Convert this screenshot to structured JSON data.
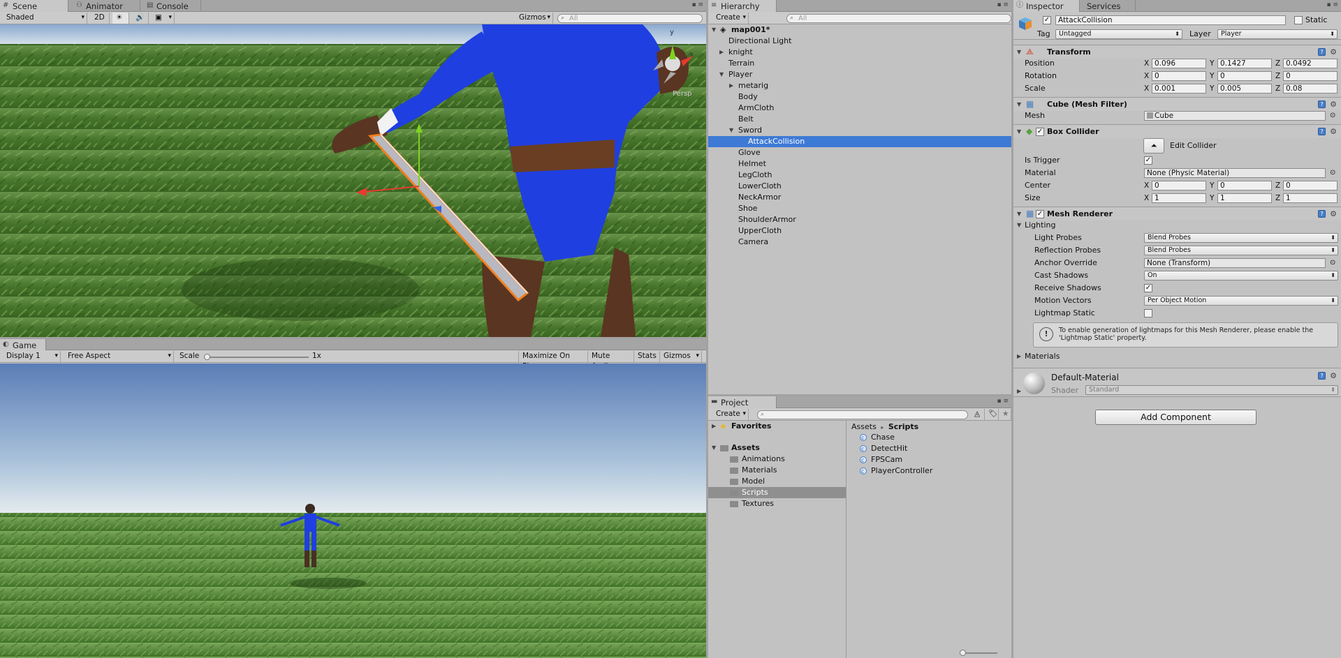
{
  "scene": {
    "tabs": [
      "Scene",
      "Animator",
      "Console"
    ],
    "shading": "Shaded",
    "mode_2d": "2D",
    "gizmos": "Gizmos",
    "search_placeholder": "All",
    "persp": "Persp",
    "axis_y": "y",
    "axis_x": "x"
  },
  "game": {
    "tab": "Game",
    "display": "Display 1",
    "aspect": "Free Aspect",
    "scale_label": "Scale",
    "scale_value": "1x",
    "maximize": "Maximize On Play",
    "mute": "Mute Audio",
    "stats": "Stats",
    "gizmos": "Gizmos"
  },
  "hierarchy": {
    "tab": "Hierarchy",
    "create": "Create",
    "search_placeholder": "All",
    "scene_name": "map001*",
    "items": [
      {
        "label": "Directional Light",
        "indent": 0,
        "arrow": ""
      },
      {
        "label": "knight",
        "indent": 0,
        "arrow": "right"
      },
      {
        "label": "Terrain",
        "indent": 0,
        "arrow": ""
      },
      {
        "label": "Player",
        "indent": 0,
        "arrow": "down"
      },
      {
        "label": "metarig",
        "indent": 1,
        "arrow": "right"
      },
      {
        "label": "Body",
        "indent": 1,
        "arrow": ""
      },
      {
        "label": "ArmCloth",
        "indent": 1,
        "arrow": ""
      },
      {
        "label": "Belt",
        "indent": 1,
        "arrow": ""
      },
      {
        "label": "Sword",
        "indent": 1,
        "arrow": "down"
      },
      {
        "label": "AttackCollision",
        "indent": 2,
        "arrow": "",
        "selected": true
      },
      {
        "label": "Glove",
        "indent": 1,
        "arrow": ""
      },
      {
        "label": "Helmet",
        "indent": 1,
        "arrow": ""
      },
      {
        "label": "LegCloth",
        "indent": 1,
        "arrow": ""
      },
      {
        "label": "LowerCloth",
        "indent": 1,
        "arrow": ""
      },
      {
        "label": "NeckArmor",
        "indent": 1,
        "arrow": ""
      },
      {
        "label": "Shoe",
        "indent": 1,
        "arrow": ""
      },
      {
        "label": "ShoulderArmor",
        "indent": 1,
        "arrow": ""
      },
      {
        "label": "UpperCloth",
        "indent": 1,
        "arrow": ""
      },
      {
        "label": "Camera",
        "indent": 1,
        "arrow": ""
      }
    ]
  },
  "project": {
    "tab": "Project",
    "create": "Create",
    "favorites": "Favorites",
    "assets": "Assets",
    "folders": [
      "Animations",
      "Materials",
      "Model",
      "Scripts",
      "Textures"
    ],
    "selected_folder": "Scripts",
    "breadcrumb_root": "Assets",
    "breadcrumb_sep": "▸",
    "breadcrumb_current": "Scripts",
    "files": [
      "Chase",
      "DetectHit",
      "FPSCam",
      "PlayerController"
    ]
  },
  "inspector": {
    "tabs": [
      "Inspector",
      "Services"
    ],
    "object_name": "AttackCollision",
    "static_label": "Static",
    "tag_label": "Tag",
    "tag_value": "Untagged",
    "layer_label": "Layer",
    "layer_value": "Player",
    "transform": {
      "title": "Transform",
      "position_label": "Position",
      "rotation_label": "Rotation",
      "scale_label": "Scale",
      "position": [
        "0.096",
        "0.1427",
        "0.0492"
      ],
      "rotation": [
        "0",
        "0",
        "0"
      ],
      "scale": [
        "0.001",
        "0.005",
        "0.08"
      ]
    },
    "mesh_filter": {
      "title": "Cube (Mesh Filter)",
      "mesh_label": "Mesh",
      "mesh_value": "Cube"
    },
    "box_collider": {
      "title": "Box Collider",
      "edit_collider": "Edit Collider",
      "is_trigger_label": "Is Trigger",
      "material_label": "Material",
      "material_value": "None (Physic Material)",
      "center_label": "Center",
      "center": [
        "0",
        "0",
        "0"
      ],
      "size_label": "Size",
      "size": [
        "1",
        "1",
        "1"
      ]
    },
    "mesh_renderer": {
      "title": "Mesh Renderer",
      "lighting_label": "Lighting",
      "light_probes_label": "Light Probes",
      "light_probes_value": "Blend Probes",
      "reflection_probes_label": "Reflection Probes",
      "reflection_probes_value": "Blend Probes",
      "anchor_override_label": "Anchor Override",
      "anchor_override_value": "None (Transform)",
      "cast_shadows_label": "Cast Shadows",
      "cast_shadows_value": "On",
      "receive_shadows_label": "Receive Shadows",
      "motion_vectors_label": "Motion Vectors",
      "motion_vectors_value": "Per Object Motion",
      "lightmap_static_label": "Lightmap Static",
      "info_text": "To enable generation of lightmaps for this Mesh Renderer, please enable the 'Lightmap Static' property.",
      "materials_label": "Materials"
    },
    "material": {
      "name": "Default-Material",
      "shader_label": "Shader",
      "shader_value": "Standard"
    },
    "add_component": "Add Component",
    "axis_x": "X",
    "axis_y": "Y",
    "axis_z": "Z",
    "check": "✓"
  },
  "colors": {
    "selection": "#3d7ad6",
    "selection_outline": "#f08020",
    "player_blue": "#1f3fe0"
  }
}
